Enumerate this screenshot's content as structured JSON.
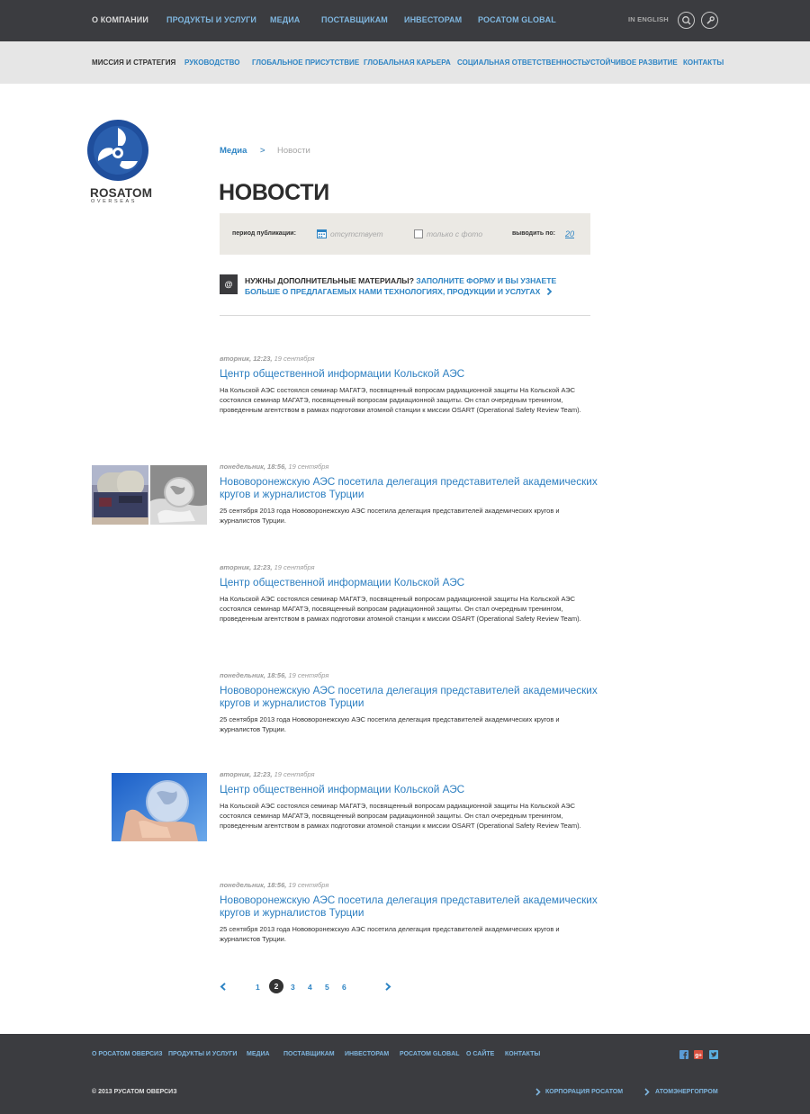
{
  "top_nav": {
    "items": [
      "О компании",
      "Продукты и услуги",
      "Медиа",
      "Поставщикам",
      "Инвесторам",
      "Росатом Global"
    ],
    "lang": "IN ENGLISH",
    "search_icon": "search-icon",
    "settings_icon": "wrench-icon"
  },
  "sub_nav": {
    "items": [
      "Миссия и стратегия",
      "Руководство",
      "Глобальное присутствие",
      "Глобальная карьера",
      "Социальная ответственность",
      "Устойчивое развитие",
      "Контакты"
    ]
  },
  "logo": {
    "word": "ROSATOM",
    "sub": "OVERSEAS"
  },
  "breadcrumb": {
    "parent": "Медиа",
    "separator": ">",
    "current": "Новости"
  },
  "page_title": "НОВОСТИ",
  "filter": {
    "period_label": "период публикации:",
    "period_value": "отсутствует",
    "photo_label": "только с фото",
    "perpage_label": "выводить по:",
    "perpage_value": "20"
  },
  "promo": {
    "box": "@",
    "dark_text": "Нужны дополнительные материалы?",
    "link_text": "Заполните форму и вы узнаете больше о предлагаемых нами технологиях, продукции и услугах"
  },
  "news": [
    {
      "time": "вторник, 12:23,",
      "day": "19 сентября",
      "title": "Центр общественной информации Кольской АЭС",
      "text": "На Кольской АЭС состоялся семинар МАГАТЭ, посвященный вопросам радиационной защиты На Кольской АЭС состоялся семинар МАГАТЭ, посвященный вопросам радиационной защиты. Он стал очередным тренингом, проведенным агентством в рамках подготовки атомной станции к миссии OSART (Operational Safety Review Team)."
    },
    {
      "time": "понедельник, 18:56,",
      "day": "19 сентября",
      "title": "Нововоронежскую АЭС посетила делегация представителей академических кругов и журналистов Турции",
      "text": "25 сентября 2013 года Нововоронежскую АЭС посетила делегация представителей академических кругов и журналистов Турции."
    },
    {
      "time": "вторник, 12:23,",
      "day": "19 сентября",
      "title": "Центр общественной информации Кольской АЭС",
      "text": "На Кольской АЭС состоялся семинар МАГАТЭ, посвященный вопросам радиационной защиты На Кольской АЭС состоялся семинар МАГАТЭ, посвященный вопросам радиационной защиты. Он стал очередным тренингом, проведенным агентством в рамках подготовки атомной станции к миссии OSART (Operational Safety Review Team)."
    },
    {
      "time": "понедельник, 18:56,",
      "day": "19 сентября",
      "title": "Нововоронежскую АЭС посетила делегация представителей академических кругов и журналистов Турции",
      "text": "25 сентября 2013 года Нововоронежскую АЭС посетила делегация представителей академических кругов и журналистов Турции."
    },
    {
      "time": "вторник, 12:23,",
      "day": "19 сентября",
      "title": "Центр общественной информации Кольской АЭС",
      "text": "На Кольской АЭС состоялся семинар МАГАТЭ, посвященный вопросам радиационной защиты На Кольской АЭС состоялся семинар МАГАТЭ, посвященный вопросам радиационной защиты. Он стал очередным тренингом, проведенным агентством в рамках подготовки атомной станции к миссии OSART (Operational Safety Review Team)."
    },
    {
      "time": "понедельник, 18:56,",
      "day": "19 сентября",
      "title": "Нововоронежскую АЭС посетила делегация представителей академических кругов и журналистов Турции",
      "text": "25 сентября 2013 года Нововоронежскую АЭС посетила делегация представителей академических кругов и журналистов Турции."
    }
  ],
  "pagination": {
    "pages": [
      "1",
      "2",
      "3",
      "4",
      "5",
      "6"
    ],
    "current": "2"
  },
  "footer": {
    "items": [
      "О Росатом Оверсиз",
      "Продукты и услуги",
      "Медиа",
      "Поставщикам",
      "Инвесторам",
      "Росатом Global",
      "О сайте",
      "Контакты"
    ],
    "copyright": "© 2013 РУСАТОМ ОВЕРСИЗ",
    "links": [
      "Корпорация Росатом",
      "Атомэнергопром"
    ],
    "social_icons": [
      "facebook-icon",
      "google-plus-icon",
      "twitter-icon"
    ]
  },
  "colors": {
    "accent": "#2d84c4",
    "dark_bar": "#3b3c40",
    "sub_bar": "#e6e6e6",
    "filter_bg": "#ebe9e4"
  }
}
